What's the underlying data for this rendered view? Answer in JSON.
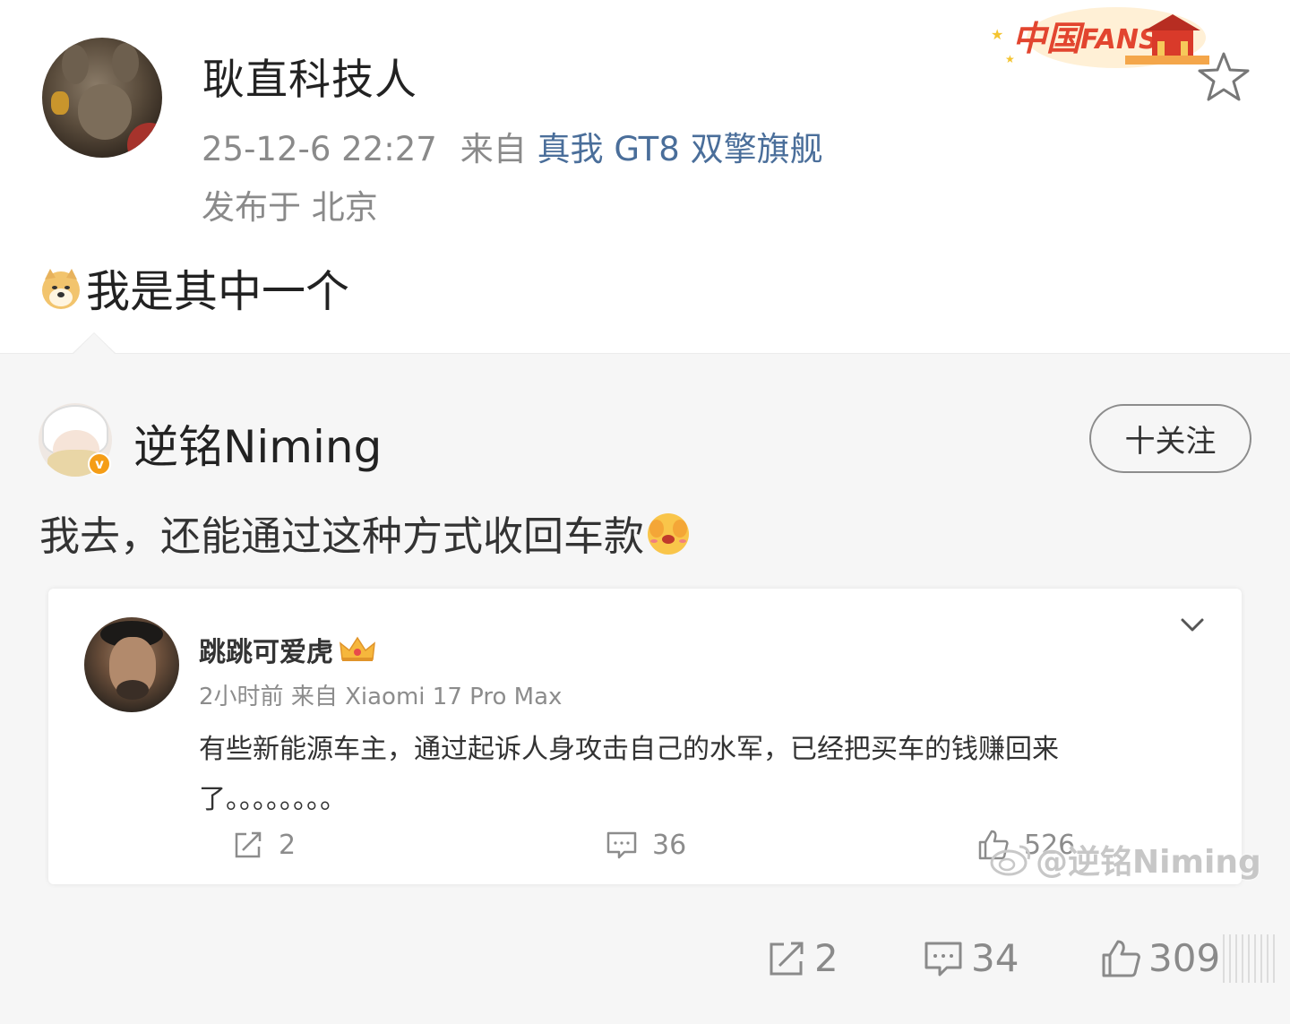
{
  "post": {
    "author": "耿直科技人",
    "time": "25-12-6 22:27",
    "from_label": "来自",
    "device": "真我 GT8 双擎旗舰",
    "location": "发布于 北京",
    "text": "我是其中一个",
    "badge_text": "中国FANS"
  },
  "repost": {
    "author": "逆铭Niming",
    "follow_label": "十关注",
    "text": "我去，还能通过这种方式收回车款",
    "card": {
      "author": "跳跳可爱虎",
      "time": "2小时前",
      "from_label": "来自",
      "device": "Xiaomi 17 Pro Max",
      "text": "有些新能源车主，通过起诉人身攻击自己的水军，已经把买车的钱赚回来了。。。。。。。。",
      "reposts": "2",
      "comments": "36",
      "likes": "526"
    },
    "watermark": "@逆铭Niming"
  },
  "actions": {
    "reposts": "2",
    "comments": "34",
    "likes": "309"
  },
  "colors": {
    "link": "#4a6e9a",
    "meta": "#8a8a8a",
    "background": "#f6f6f6",
    "verified": "#f59d16"
  },
  "icons": [
    "doge-icon",
    "shy-icon",
    "star-icon",
    "crown-icon",
    "chevron-down-icon",
    "repost-icon",
    "comment-icon",
    "like-icon",
    "weibo-logo-icon"
  ]
}
